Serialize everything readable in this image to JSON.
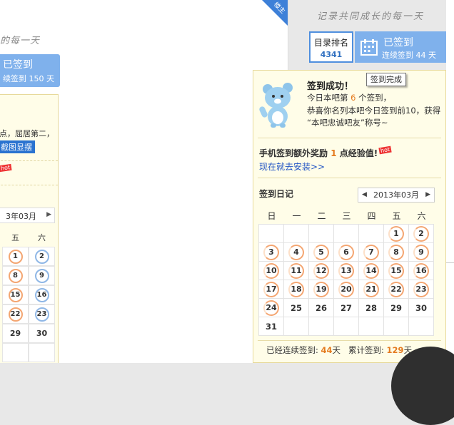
{
  "background": {
    "corner_badge": "楼主",
    "slogan": "的每一天",
    "signed_title": "已签到",
    "signed_sub": "续签到 150 天",
    "text1": "点，屈居第二，",
    "highlight": "截图显摆",
    "hot": "hot",
    "month": "3年03月",
    "weekdays": [
      "五",
      "六"
    ],
    "days": [
      "1",
      "2",
      "8",
      "9",
      "15",
      "16",
      "22",
      "23",
      "29",
      "30",
      "",
      ""
    ]
  },
  "header": {
    "slogan": "记录共同成长的每一天",
    "rank_label": "目录排名",
    "rank_value": "4341",
    "signed_title": "已签到",
    "signed_sub": "连续签到 44 天",
    "tooltip": "签到完成"
  },
  "popup": {
    "title": "签到成功！",
    "line1_pre": "今日本吧第",
    "line1_num": "6",
    "line1_post": "个签到，",
    "line2": "恭喜你名列本吧今日签到前10，获得",
    "line3": "“本吧忠诚吧友”称号~",
    "bonus_pre": "手机签到额外奖励",
    "bonus_num": "1",
    "bonus_post": "点经验值!",
    "hot": "hot",
    "install_link": "现在就去安装>>",
    "diary_title": "签到日记",
    "month": "2013年03月",
    "weekdays": [
      "日",
      "一",
      "二",
      "三",
      "四",
      "五",
      "六"
    ],
    "stats_pre": "已经连续签到:",
    "stats_streak": "44",
    "stats_unit1": "天",
    "stats_mid": "累计签到:",
    "stats_total": "129",
    "stats_unit2": "天"
  },
  "calendar": {
    "lead_blank": 5,
    "days": [
      {
        "d": "1",
        "s": true
      },
      {
        "d": "2",
        "s": true
      },
      {
        "d": "3",
        "s": true
      },
      {
        "d": "4",
        "s": true
      },
      {
        "d": "5",
        "s": true
      },
      {
        "d": "6",
        "s": true
      },
      {
        "d": "7",
        "s": true
      },
      {
        "d": "8",
        "s": true
      },
      {
        "d": "9",
        "s": true
      },
      {
        "d": "10",
        "s": true
      },
      {
        "d": "11",
        "s": true
      },
      {
        "d": "12",
        "s": true
      },
      {
        "d": "13",
        "s": true
      },
      {
        "d": "14",
        "s": true
      },
      {
        "d": "15",
        "s": true
      },
      {
        "d": "16",
        "s": true
      },
      {
        "d": "17",
        "s": true
      },
      {
        "d": "18",
        "s": true
      },
      {
        "d": "19",
        "s": true
      },
      {
        "d": "20",
        "s": true
      },
      {
        "d": "21",
        "s": true
      },
      {
        "d": "22",
        "s": true
      },
      {
        "d": "23",
        "s": true
      },
      {
        "d": "24",
        "s": true
      },
      {
        "d": "25",
        "s": false
      },
      {
        "d": "26",
        "s": false
      },
      {
        "d": "27",
        "s": false
      },
      {
        "d": "28",
        "s": false
      },
      {
        "d": "29",
        "s": false
      },
      {
        "d": "30",
        "s": false
      },
      {
        "d": "31",
        "s": false
      }
    ],
    "trail_blank": 6
  },
  "colors": {
    "accent_blue": "#7fb1ec",
    "ring_orange": "#f4a672",
    "popup_bg": "#fffde8",
    "number_orange": "#e47b1f"
  }
}
